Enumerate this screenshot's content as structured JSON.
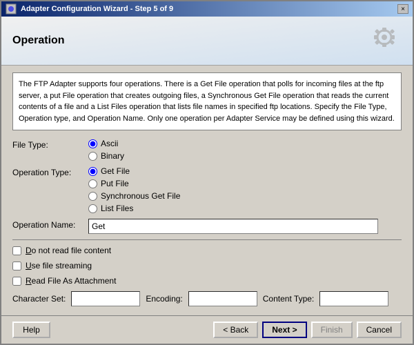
{
  "window": {
    "title": "Adapter Configuration Wizard - Step 5 of 9",
    "close_label": "×"
  },
  "header": {
    "title": "Operation",
    "gear_icon": "gear"
  },
  "description": "The FTP Adapter supports four operations.  There is a Get File operation that polls for incoming files at the ftp server, a put File operation that creates outgoing files, a Synchronous Get File operation that reads the current contents of a file and a List Files operation that lists file names in specified ftp locations.  Specify the File Type, Operation type, and Operation Name.  Only one operation per Adapter Service may be defined using this wizard.",
  "file_type": {
    "label": "File Type:",
    "options": [
      {
        "id": "ascii",
        "label": "Ascii",
        "checked": true
      },
      {
        "id": "binary",
        "label": "Binary",
        "checked": false
      }
    ]
  },
  "operation_type": {
    "label": "Operation Type:",
    "options": [
      {
        "id": "get_file",
        "label": "Get File",
        "checked": true
      },
      {
        "id": "put_file",
        "label": "Put File",
        "checked": false
      },
      {
        "id": "sync_get",
        "label": "Synchronous Get File",
        "checked": false
      },
      {
        "id": "list_files",
        "label": "List Files",
        "checked": false
      }
    ]
  },
  "operation_name": {
    "label": "Operation Name:",
    "value": "Get"
  },
  "checkboxes": [
    {
      "id": "no_read",
      "label": "Do not read file content",
      "checked": false
    },
    {
      "id": "streaming",
      "label": "Use file streaming",
      "checked": false
    },
    {
      "id": "attachment",
      "label": "Read File As Attachment",
      "checked": false
    }
  ],
  "bottom_fields": [
    {
      "label": "Character Set:",
      "value": ""
    },
    {
      "label": "Encoding:",
      "value": ""
    },
    {
      "label": "Content Type:",
      "value": ""
    }
  ],
  "footer": {
    "help_label": "Help",
    "back_label": "< Back",
    "next_label": "Next >",
    "finish_label": "Finish",
    "cancel_label": "Cancel"
  }
}
